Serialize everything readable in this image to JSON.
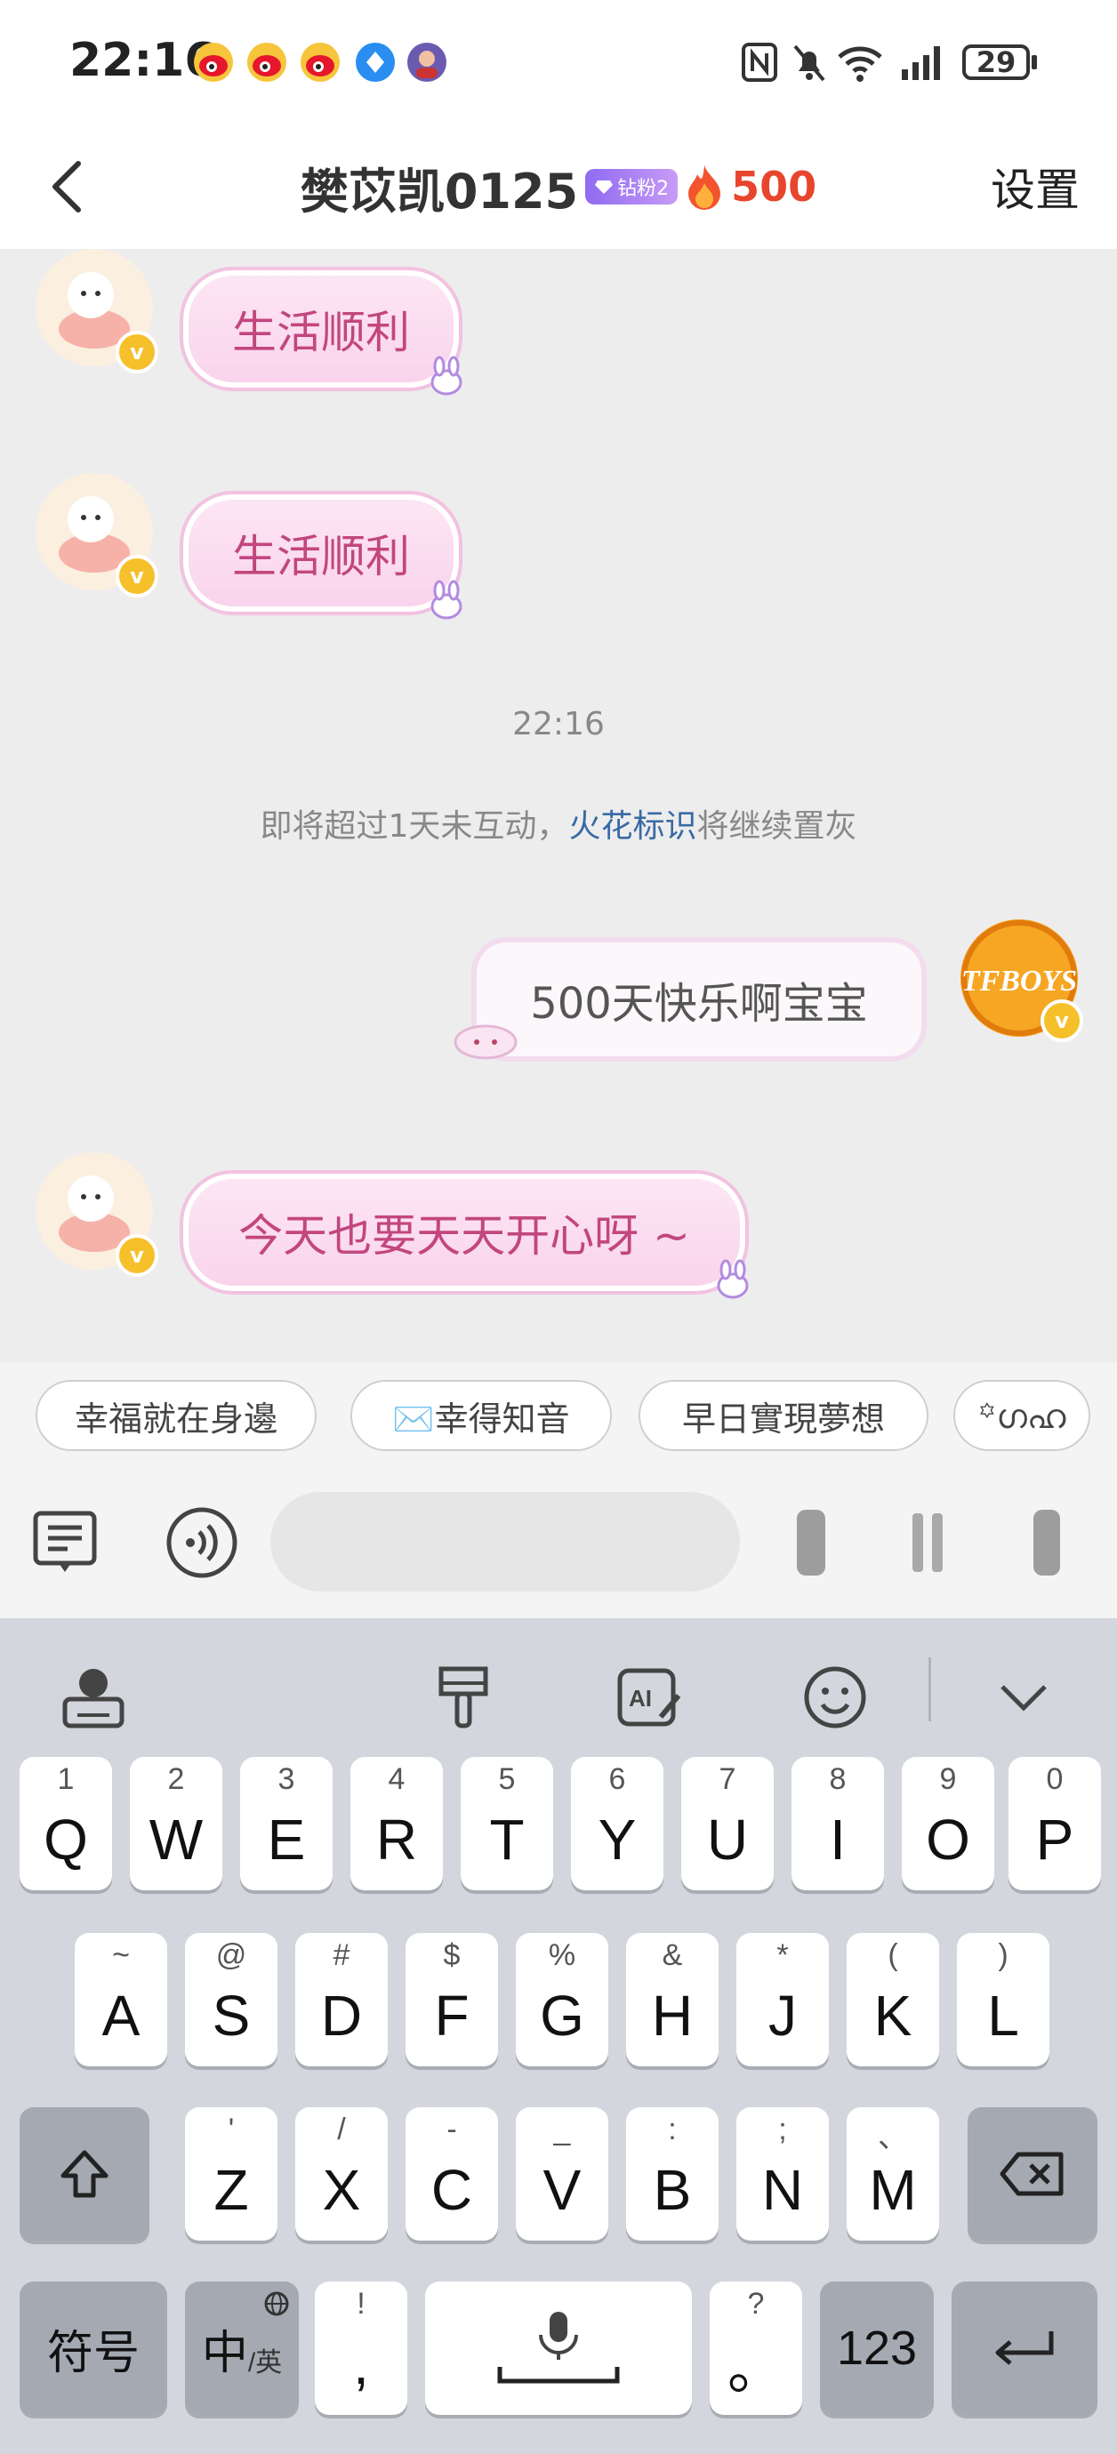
{
  "status_bar": {
    "time": "22:16",
    "battery": "29",
    "icons": [
      "weibo-icon",
      "weibo-icon",
      "weibo-icon",
      "browser-icon",
      "game-avatar-icon",
      "nfc-icon",
      "mute-icon",
      "wifi-icon",
      "signal-icon",
      "battery-icon"
    ]
  },
  "header": {
    "title": "樊苡凯0125",
    "fan_badge": "钻粉2",
    "streak_count": "500",
    "settings_label": "设置"
  },
  "messages": [
    {
      "side": "left",
      "text": "生活顺利"
    },
    {
      "side": "left",
      "text": "生活顺利"
    },
    {
      "type": "timestamp",
      "text": "22:16"
    },
    {
      "type": "system",
      "text_before": "即将超过1天未互动，",
      "link": "火花标识",
      "text_after": "将继续置灰"
    },
    {
      "side": "right",
      "text": "500天快乐啊宝宝"
    },
    {
      "side": "left",
      "text": "今天也要天天开心呀 ~"
    }
  ],
  "quick_replies": [
    "幸福就在身邊",
    "✉️幸得知音",
    "早日實現夢想",
    "꙳ഗഹ"
  ],
  "input": {
    "placeholder": "",
    "value": ""
  },
  "keyboard": {
    "row1": [
      {
        "num": "1",
        "key": "Q"
      },
      {
        "num": "2",
        "key": "W"
      },
      {
        "num": "3",
        "key": "E"
      },
      {
        "num": "4",
        "key": "R"
      },
      {
        "num": "5",
        "key": "T"
      },
      {
        "num": "6",
        "key": "Y"
      },
      {
        "num": "7",
        "key": "U"
      },
      {
        "num": "8",
        "key": "I"
      },
      {
        "num": "9",
        "key": "O"
      },
      {
        "num": "0",
        "key": "P"
      }
    ],
    "row2": [
      {
        "num": "~",
        "key": "A"
      },
      {
        "num": "@",
        "key": "S"
      },
      {
        "num": "#",
        "key": "D"
      },
      {
        "num": "$",
        "key": "F"
      },
      {
        "num": "%",
        "key": "G"
      },
      {
        "num": "&",
        "key": "H"
      },
      {
        "num": "*",
        "key": "J"
      },
      {
        "num": "(",
        "key": "K"
      },
      {
        "num": ")",
        "key": "L"
      }
    ],
    "row3": [
      {
        "num": "'",
        "key": "Z"
      },
      {
        "num": "/",
        "key": "X"
      },
      {
        "num": "-",
        "key": "C"
      },
      {
        "num": "_",
        "key": "V"
      },
      {
        "num": ":",
        "key": "B"
      },
      {
        "num": ";",
        "key": "N"
      },
      {
        "num": "、",
        "key": "M"
      }
    ],
    "symbol_key": "符号",
    "lang_key": "中",
    "lang_sub": "/英",
    "comma_hint": "!",
    "comma_key": ",",
    "period_hint": "?",
    "period_key": "。",
    "num_key": "123"
  }
}
